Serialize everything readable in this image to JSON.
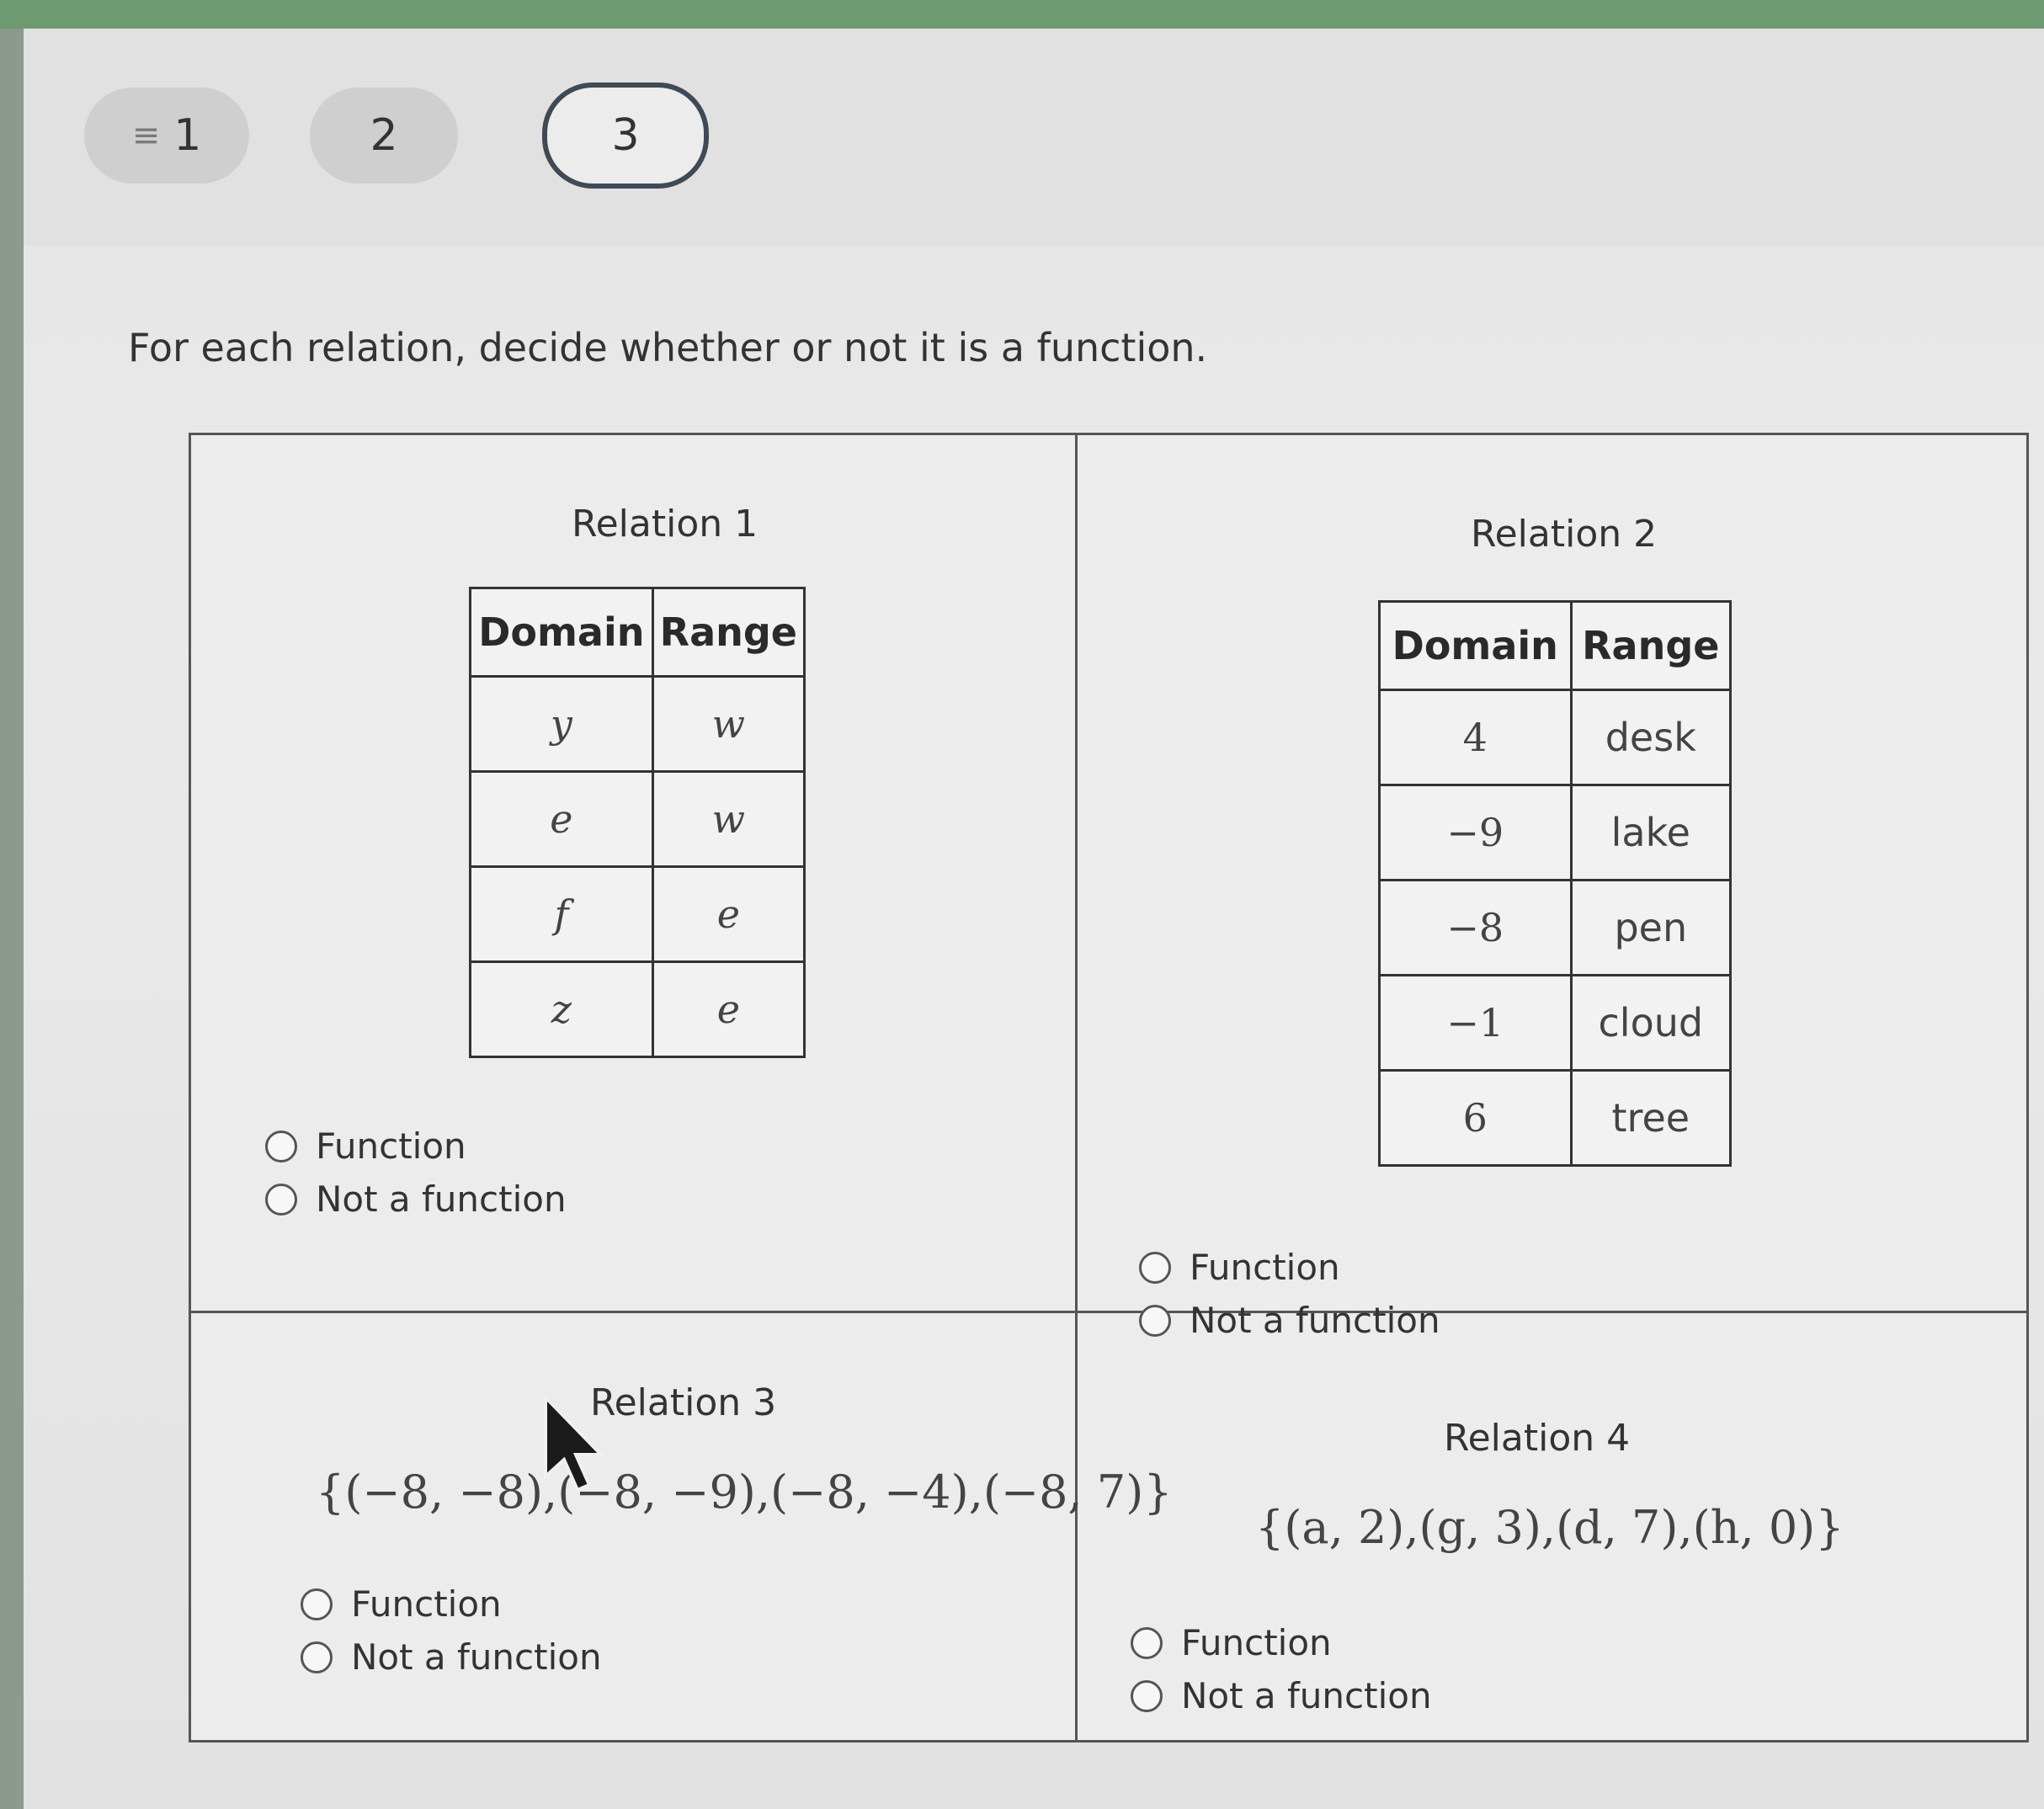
{
  "steps": [
    {
      "label": "1",
      "icon": "menu-lines-icon"
    },
    {
      "label": "2"
    },
    {
      "label": "3",
      "active": true
    }
  ],
  "instructions": "For each relation, decide whether or not it is a function.",
  "relations": {
    "r1": {
      "title": "Relation 1",
      "headers": [
        "Domain",
        "Range"
      ],
      "rows": [
        [
          "y",
          "w"
        ],
        [
          "e",
          "w"
        ],
        [
          "f",
          "e"
        ],
        [
          "z",
          "e"
        ]
      ]
    },
    "r2": {
      "title": "Relation 2",
      "headers": [
        "Domain",
        "Range"
      ],
      "rows": [
        [
          "4",
          "desk"
        ],
        [
          "−9",
          "lake"
        ],
        [
          "−8",
          "pen"
        ],
        [
          "−1",
          "cloud"
        ],
        [
          "6",
          "tree"
        ]
      ]
    },
    "r3": {
      "title": "Relation 3",
      "set": "{(−8, −8),(−8, −9),(−8, −4),(−8, 7)}"
    },
    "r4": {
      "title": "Relation 4",
      "set": "{(a, 2),(g, 3),(d, 7),(h, 0)}"
    }
  },
  "options": {
    "function": "Function",
    "not_function": "Not a function"
  }
}
